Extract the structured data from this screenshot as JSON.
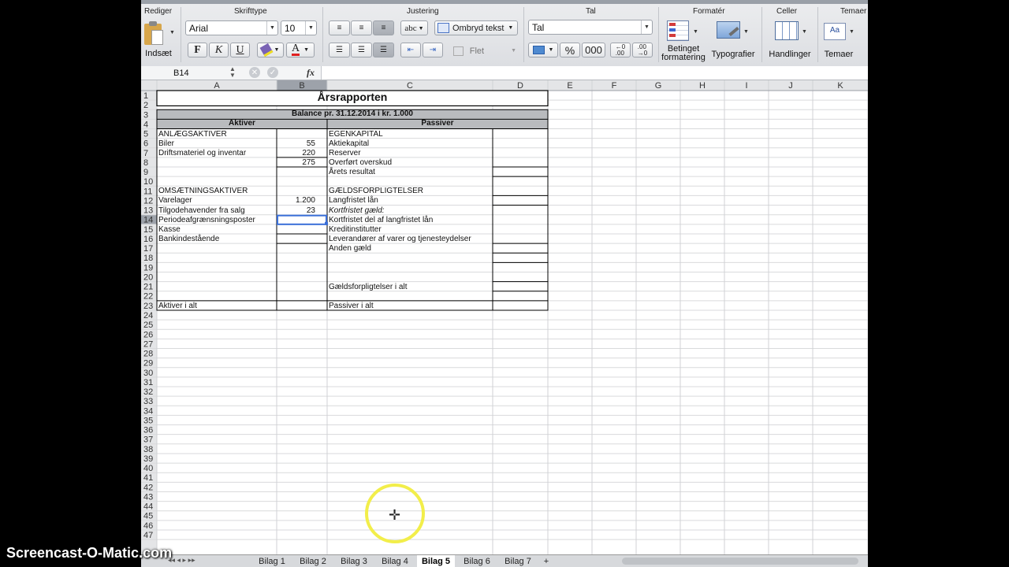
{
  "ribbon": {
    "groups": [
      "Rediger",
      "Skrifttype",
      "Justering",
      "Tal",
      "Formatér",
      "Celler",
      "Temaer"
    ],
    "paste_label": "Indsæt",
    "font_name": "Arial",
    "font_size": "10",
    "bold": "F",
    "italic": "K",
    "underline": "U",
    "wrap_text": "Ombryd tekst",
    "merge": "Flet",
    "number_format": "Tal",
    "percent": "%",
    "thousands": "000",
    "abc": "abc",
    "conditional_formatting": "Betinget formatering",
    "styles": "Typografier",
    "actions": "Handlinger",
    "themes": "Temaer"
  },
  "formula_bar": {
    "name_box": "B14",
    "fx": "fx",
    "content": ""
  },
  "columns": [
    "A",
    "B",
    "C",
    "D",
    "E",
    "F",
    "G",
    "H",
    "I",
    "J",
    "K"
  ],
  "row_count": 47,
  "sheet": {
    "title": "Årsrapporten",
    "balance_header": "Balance pr. 31.12.2014 i kr. 1.000",
    "aktiver_header": "Aktiver",
    "passiver_header": "Passiver",
    "cells": [
      {
        "row": 5,
        "col": "A",
        "text": "ANLÆGSAKTIVER"
      },
      {
        "row": 6,
        "col": "A",
        "text": "Biler"
      },
      {
        "row": 6,
        "col": "B",
        "text": "55"
      },
      {
        "row": 7,
        "col": "A",
        "text": "Driftsmateriel og inventar"
      },
      {
        "row": 7,
        "col": "B",
        "text": "220"
      },
      {
        "row": 8,
        "col": "B",
        "text": "275"
      },
      {
        "row": 11,
        "col": "A",
        "text": "OMSÆTNINGSAKTIVER"
      },
      {
        "row": 12,
        "col": "A",
        "text": "Varelager"
      },
      {
        "row": 12,
        "col": "B",
        "text": "1.200"
      },
      {
        "row": 13,
        "col": "A",
        "text": "Tilgodehavender fra salg"
      },
      {
        "row": 13,
        "col": "B",
        "text": "23"
      },
      {
        "row": 14,
        "col": "A",
        "text": "Periodeafgrænsningsposter"
      },
      {
        "row": 15,
        "col": "A",
        "text": "Kasse"
      },
      {
        "row": 16,
        "col": "A",
        "text": "Bankindestående"
      },
      {
        "row": 23,
        "col": "A",
        "text": "Aktiver i alt"
      },
      {
        "row": 5,
        "col": "C",
        "text": "EGENKAPITAL"
      },
      {
        "row": 6,
        "col": "C",
        "text": "Aktiekapital"
      },
      {
        "row": 7,
        "col": "C",
        "text": "Reserver"
      },
      {
        "row": 8,
        "col": "C",
        "text": "Overført overskud"
      },
      {
        "row": 9,
        "col": "C",
        "text": "Årets resultat"
      },
      {
        "row": 11,
        "col": "C",
        "text": "GÆLDSFORPLIGTELSER"
      },
      {
        "row": 12,
        "col": "C",
        "text": "Langfristet lån"
      },
      {
        "row": 13,
        "col": "C",
        "text": "Kortfristet gæld:",
        "italic": true
      },
      {
        "row": 14,
        "col": "C",
        "text": "Kortfristet del af langfristet lån"
      },
      {
        "row": 15,
        "col": "C",
        "text": "Kreditinstitutter"
      },
      {
        "row": 16,
        "col": "C",
        "text": "Leverandører af varer og tjenesteydelser"
      },
      {
        "row": 17,
        "col": "C",
        "text": "Anden gæld"
      },
      {
        "row": 21,
        "col": "C",
        "text": "Gældsforpligtelser i alt"
      },
      {
        "row": 23,
        "col": "C",
        "text": "Passiver i alt"
      }
    ],
    "selected_cell": "B14"
  },
  "tabs": [
    "Bilag 1",
    "Bilag 2",
    "Bilag 3",
    "Bilag 4",
    "Bilag 5",
    "Bilag 6",
    "Bilag 7",
    "+"
  ],
  "active_tab": "Bilag 5",
  "watermark": "Screencast-O-Matic.com",
  "colors": {
    "header_gray": "#b9bbbe",
    "selection": "#3a6fd8",
    "cursor_ring": "#f2ee4a"
  }
}
